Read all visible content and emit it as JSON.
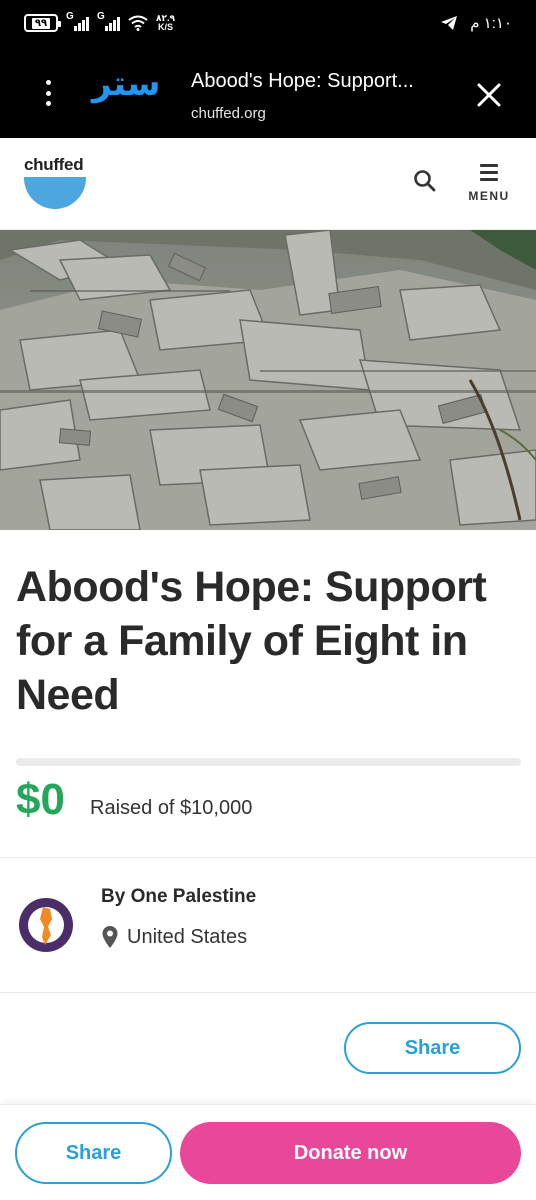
{
  "status_bar": {
    "battery": "٩٩",
    "signal_1_label": "G",
    "signal_2_label": "G",
    "speed_value": "٨٢.٩",
    "speed_unit": "K/S",
    "time": "١:١٠ م",
    "icons": [
      "battery-icon",
      "signal-icon",
      "signal-icon",
      "wifi-icon",
      "telegram-icon"
    ]
  },
  "browser": {
    "app_logo_text": "ستر",
    "page_title": "Abood's Hope: Support...",
    "url": "chuffed.org",
    "icons": [
      "kebab-menu-icon",
      "close-icon"
    ],
    "logo_color": "#2196f3"
  },
  "site_header": {
    "logo_word": "chuffed",
    "menu_label": "MENU",
    "icons": [
      "search-icon",
      "hamburger-icon"
    ],
    "brand_color": "#4da6e0"
  },
  "campaign": {
    "title": "Abood's Hope: Support for a Family of Eight in Need",
    "raised_amount": "$0",
    "raised_of": "Raised of $10,000",
    "progress_fraction": 0,
    "organizer_name": "By One Palestine",
    "organizer_location": "United States",
    "share_label": "Share"
  },
  "bottom_bar": {
    "share_label": "Share",
    "donate_label": "Donate now",
    "donate_color": "#e8479a",
    "share_color": "#2a9fd8"
  },
  "colors": {
    "raised_green": "#26a65b"
  }
}
